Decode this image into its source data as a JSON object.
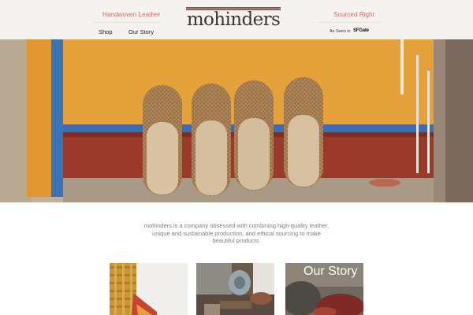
{
  "header": {
    "tagline_left": "Handwoven Leather",
    "tagline_right": "Sourced Right",
    "logo_text": "mohinders",
    "nav": [
      {
        "label": "Shop"
      },
      {
        "label": "Our Story"
      }
    ],
    "press": {
      "prefix": "As Seen in",
      "outlet": "SFGate"
    }
  },
  "intro": {
    "text": "mohinders is a company obsessed with combining high-quality leather, unique and sustainable production, and ethical sourcing to make beautiful products."
  },
  "cards": [
    {
      "title": "",
      "image": "woven-bag-photo"
    },
    {
      "title": "",
      "image": "craftsman-workshop-photo"
    },
    {
      "title": "Our Story",
      "image": "our-story-photo"
    }
  ],
  "colors": {
    "header_bg": "#f5f3ef",
    "accent": "#cf6b5f",
    "logo_text": "#3e3533"
  }
}
